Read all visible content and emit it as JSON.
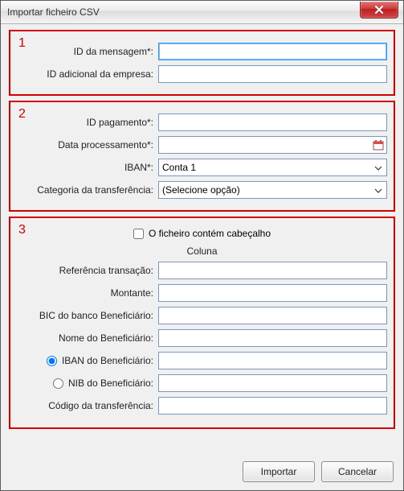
{
  "window": {
    "title": "Importar ficheiro CSV"
  },
  "section1": {
    "num": "1",
    "msg_id_label": "ID da mensagem*:",
    "msg_id_value": "",
    "company_id_label": "ID adicional da empresa:",
    "company_id_value": ""
  },
  "section2": {
    "num": "2",
    "payment_id_label": "ID pagamento*:",
    "payment_id_value": "",
    "proc_date_label": "Data processamento*:",
    "proc_date_value": "",
    "iban_label": "IBAN*:",
    "iban_value": "Conta 1",
    "category_label": "Categoria da transferência:",
    "category_value": "(Selecione opção)"
  },
  "section3": {
    "num": "3",
    "header_checkbox_label": "O ficheiro contém cabeçalho",
    "header_checked": false,
    "column_header": "Coluna",
    "ref_label": "Referência transação:",
    "ref_value": "",
    "amount_label": "Montante:",
    "amount_value": "",
    "bic_label": "BIC do banco Beneficiário:",
    "bic_value": "",
    "ben_name_label": "Nome do Beneficiário:",
    "ben_name_value": "",
    "iban_ben_label": "IBAN do Beneficiário:",
    "iban_ben_value": "",
    "nib_ben_label": "NIB do Beneficiário:",
    "nib_ben_value": "",
    "transfer_code_label": "Código da transferência:",
    "transfer_code_value": "",
    "radio_selected": "iban"
  },
  "footer": {
    "import_label": "Importar",
    "cancel_label": "Cancelar"
  }
}
